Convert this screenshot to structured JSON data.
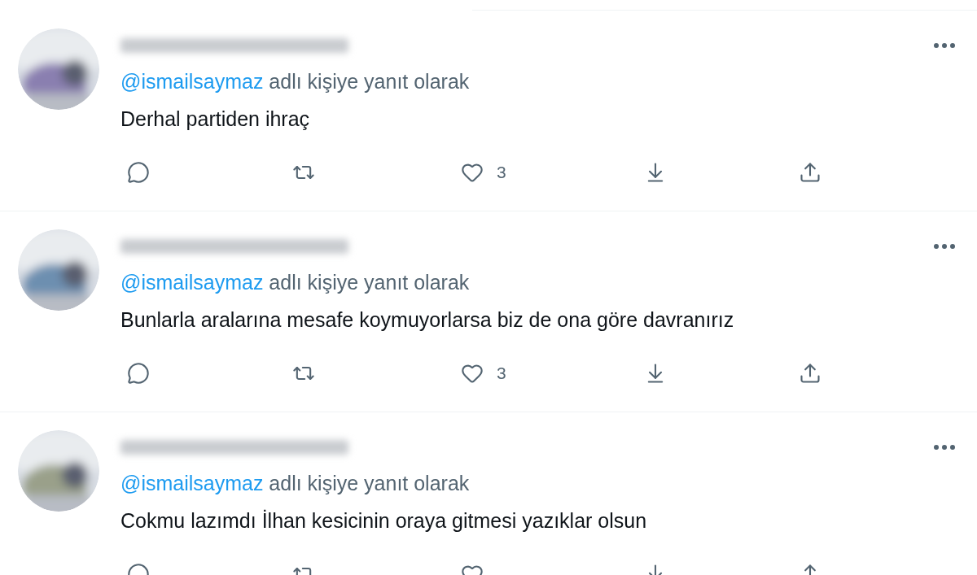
{
  "tweets": [
    {
      "reply_to": "@ismailsaymaz",
      "reply_suffix": "adlı kişiye yanıt olarak",
      "text": "Derhal partiden ihraç",
      "likes": "3"
    },
    {
      "reply_to": "@ismailsaymaz",
      "reply_suffix": "adlı kişiye yanıt olarak",
      "text": "Bunlarla aralarına mesafe koymuyorlarsa biz de ona göre davranırız",
      "likes": "3"
    },
    {
      "reply_to": "@ismailsaymaz",
      "reply_suffix": "adlı kişiye yanıt olarak",
      "text": "Cokmu lazımdı İlhan kesicinin oraya gitmesi yazıklar olsun"
    }
  ]
}
